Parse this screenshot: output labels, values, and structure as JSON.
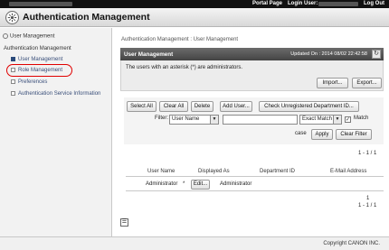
{
  "topbar": {
    "portal_link": "Portal Page",
    "login_user_label": "Login User:",
    "logout_link": "Log Out"
  },
  "app": {
    "title": "Authentication Management"
  },
  "sidebar": {
    "items": [
      {
        "label": "User Management"
      },
      {
        "label": "Authentication Management"
      },
      {
        "label": "User Management"
      },
      {
        "label": "Role Management"
      },
      {
        "label": "Preferences"
      },
      {
        "label": "Authentication Service Information"
      }
    ]
  },
  "main": {
    "breadcrumb": "Authentication Management : User Management",
    "panel_title": "User Management",
    "updated_on": "Updated On : 2014 08/02 22:42:58",
    "info_text": "The users with an asterisk (*) are administrators.",
    "import_label": "Import...",
    "export_label": "Export..."
  },
  "toolbar": {
    "select_all": "Select All",
    "clear_all": "Clear All",
    "delete": "Delete",
    "add_user": "Add User...",
    "check_unregistered": "Check Unregistered Department ID...",
    "filter_label": "Filter:",
    "filter_field": "User Name",
    "filter_value": "",
    "match_mode": "Exact Match",
    "match_case_label": "Match",
    "case_label": "case",
    "apply": "Apply",
    "clear_filter": "Clear Filter"
  },
  "pager": {
    "top_range": "1 - 1 / 1",
    "bottom_page": "1",
    "bottom_range": "1 - 1 / 1"
  },
  "table": {
    "headers": [
      "User Name",
      "Displayed As",
      "Department ID",
      "E-Mail Address"
    ],
    "rows": [
      {
        "user_name": "Administrator",
        "marker": "*",
        "edit_label": "Edit...",
        "displayed_as": "Administrator",
        "department_id": "",
        "email": ""
      }
    ]
  },
  "footer": {
    "copyright": "Copyright CANON INC."
  }
}
